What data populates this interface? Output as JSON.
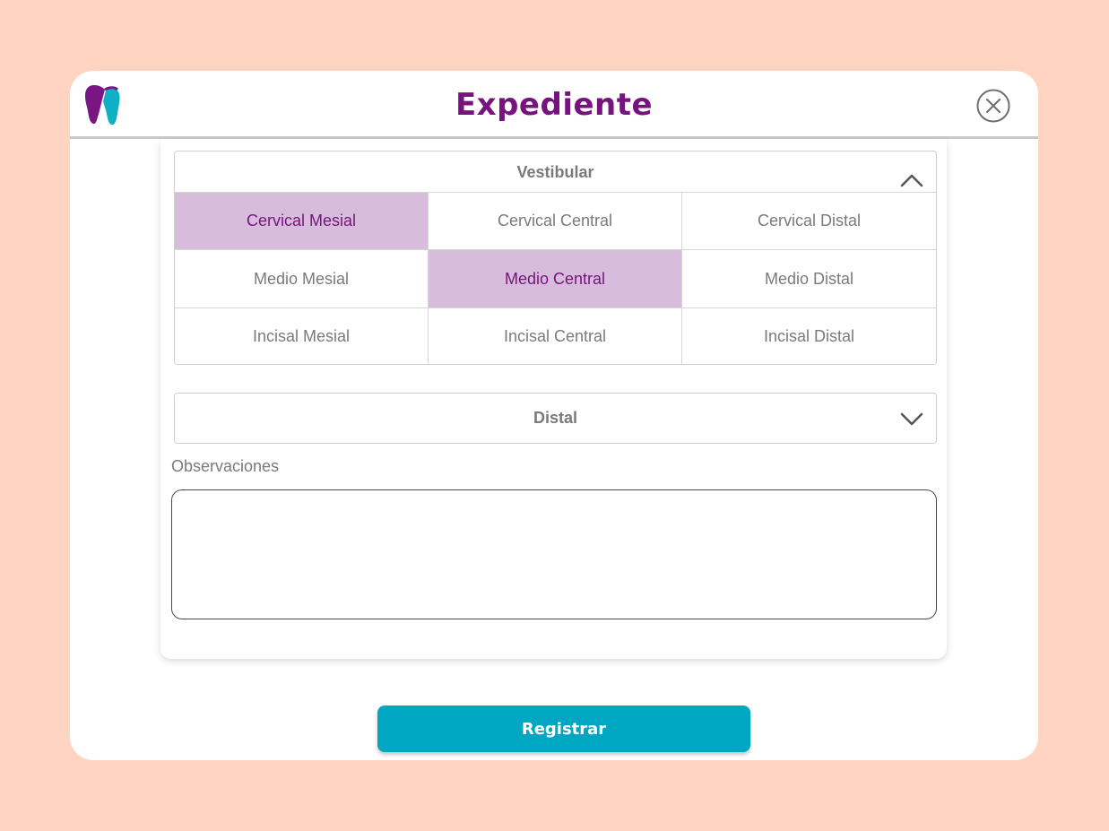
{
  "header": {
    "title": "Expediente",
    "logo_icon": "tooth-logo-icon",
    "close_icon": "close-circle-icon"
  },
  "vestibular": {
    "title": "Vestibular",
    "expanded": true,
    "toggle_icon": "chevron-up-icon",
    "cells": [
      {
        "label": "Cervical Mesial",
        "selected": true
      },
      {
        "label": "Cervical Central",
        "selected": false
      },
      {
        "label": "Cervical Distal",
        "selected": false
      },
      {
        "label": "Medio Mesial",
        "selected": false
      },
      {
        "label": "Medio Central",
        "selected": true
      },
      {
        "label": "Medio Distal",
        "selected": false
      },
      {
        "label": "Incisal Mesial",
        "selected": false
      },
      {
        "label": "Incisal Central",
        "selected": false
      },
      {
        "label": "Incisal Distal",
        "selected": false
      }
    ]
  },
  "distal": {
    "title": "Distal",
    "expanded": false,
    "toggle_icon": "chevron-down-icon"
  },
  "observaciones": {
    "label": "Observaciones",
    "value": "",
    "placeholder": ""
  },
  "actions": {
    "register_label": "Registrar"
  },
  "colors": {
    "background": "#FFD4C0",
    "title": "#76137F",
    "selected_cell_bg": "#D7BCDB",
    "selected_cell_text": "#76137F",
    "button": "#00A7C2",
    "logo_purple": "#7A1684",
    "logo_teal": "#11AFC3"
  }
}
